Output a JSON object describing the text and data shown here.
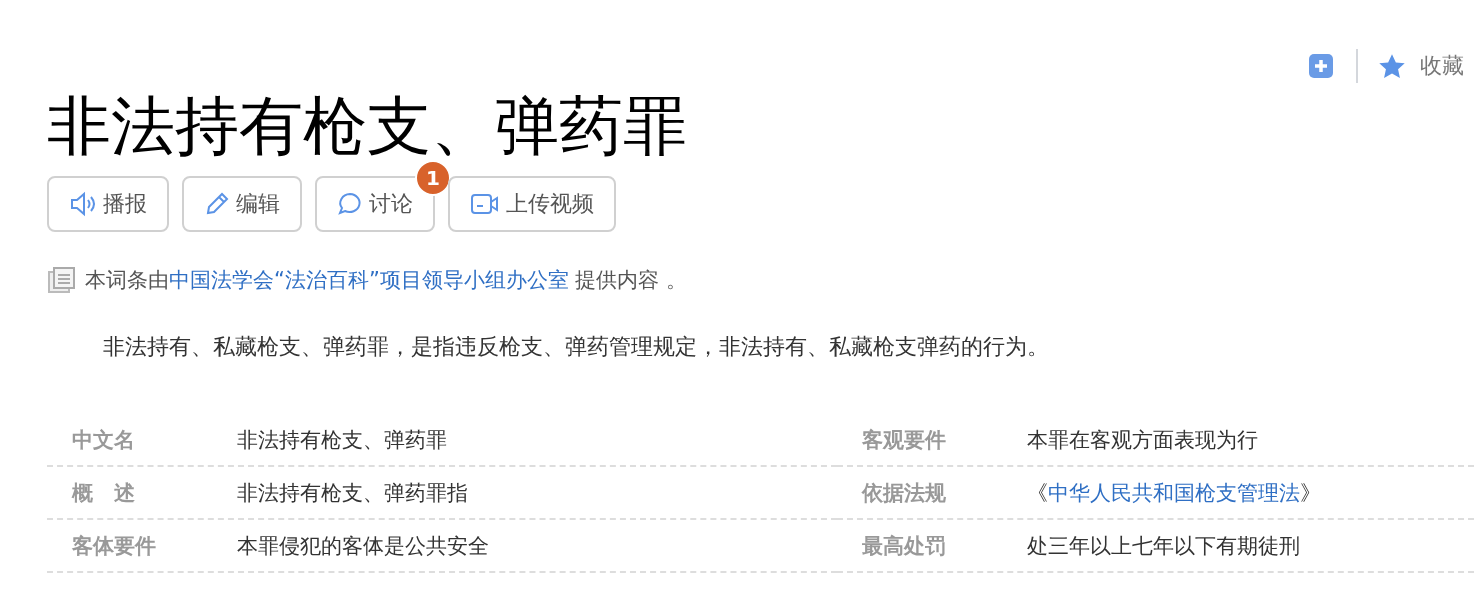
{
  "toolbar": {
    "favorite": "收藏"
  },
  "title": "非法持有枪支、弹药罪",
  "actions": [
    {
      "kind": "broadcast",
      "label": "播报"
    },
    {
      "kind": "edit",
      "label": "编辑"
    },
    {
      "kind": "discuss",
      "label": "讨论",
      "badge": "1"
    },
    {
      "kind": "video",
      "label": "上传视频"
    }
  ],
  "source": {
    "prefix": "本词条由",
    "link": "中国法学会“法治百科”项目领导小组办公室",
    "suffix": "提供内容 。"
  },
  "summary": "非法持有、私藏枪支、弹药罪，是指违反枪支、弹药管理规定，非法持有、私藏枪支弹药的行为。",
  "info": [
    {
      "label": "中文名",
      "value": "非法持有枪支、弹药罪"
    },
    {
      "label": "客观要件",
      "value": "本罪在客观方面表现为行"
    },
    {
      "label": "概　述",
      "value": "非法持有枪支、弹药罪指"
    },
    {
      "label": "依据法规",
      "value": "《",
      "link": "中华人民共和国枪支管理法",
      "after": "》"
    },
    {
      "label": "客体要件",
      "value": "本罪侵犯的客体是公共安全"
    },
    {
      "label": "最高处罚",
      "value": "处三年以上七年以下有期徒刑"
    }
  ]
}
